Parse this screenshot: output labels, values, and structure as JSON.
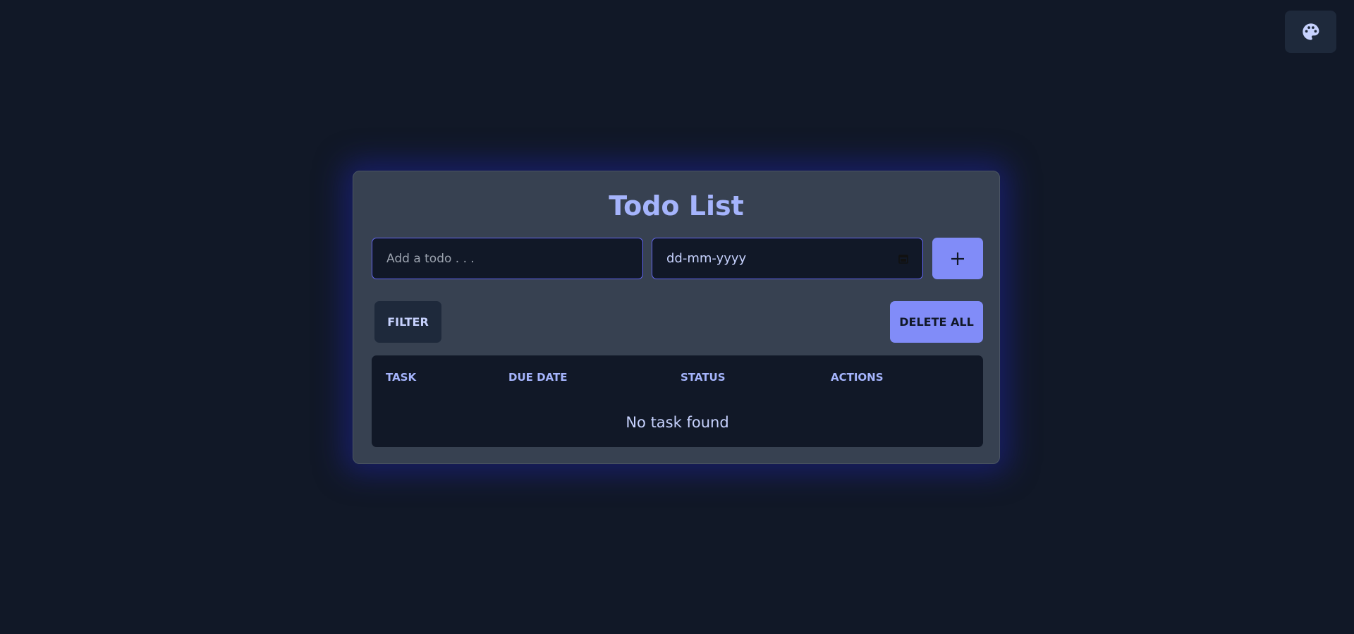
{
  "theme_toggle": {
    "icon": "palette-icon"
  },
  "app": {
    "title": "Todo List"
  },
  "form": {
    "todo_placeholder": "Add a todo . . .",
    "date_placeholder": "dd-mm-yyyy",
    "add_icon": "plus-icon"
  },
  "toolbar": {
    "filter_label": "FILTER",
    "delete_all_label": "DELETE ALL"
  },
  "table": {
    "columns": [
      "TASK",
      "DUE DATE",
      "STATUS",
      "ACTIONS"
    ],
    "empty_message": "No task found"
  },
  "colors": {
    "background": "#111827",
    "card": "#374151",
    "accent": "#818cf8",
    "text_accent": "#a5b4fc"
  }
}
